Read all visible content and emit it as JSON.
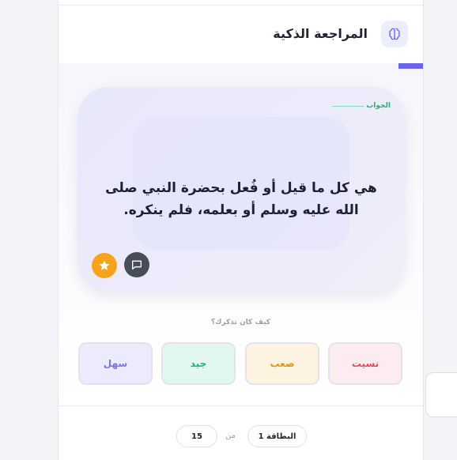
{
  "header": {
    "title": "المراجعة الذكية",
    "icon": "brain-icon"
  },
  "progress": {
    "fraction": 0.067
  },
  "card": {
    "label": "الجواب",
    "answer": "هي كل ما قيل أو فُعل بحضرة النبي صلى الله عليه وسلم أو بعلمه، فلم ينكره."
  },
  "rating": {
    "question": "كيف كان تذكرك؟",
    "options": [
      "نسيت",
      "صعب",
      "جيد",
      "سهل"
    ]
  },
  "footer": {
    "card_label": "البطاقة 1",
    "of_label": "من",
    "total": "15"
  },
  "colors": {
    "accent": "#6b63f2",
    "forgot": "#e6495f",
    "hard": "#e3941b",
    "good": "#1fae6f",
    "easy": "#7a74e6",
    "star": "#f7a21b"
  }
}
